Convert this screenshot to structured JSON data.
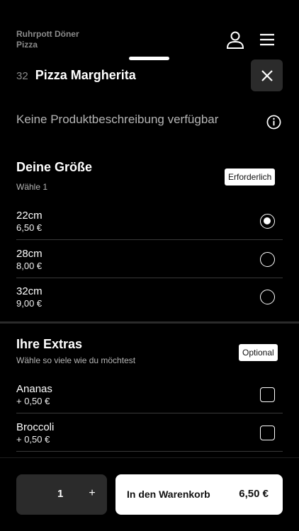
{
  "header": {
    "brand_line1": "Ruhrpott Döner",
    "brand_line2": "Pizza",
    "icons": [
      "user-icon",
      "menu-icon"
    ]
  },
  "product": {
    "number": "32",
    "name": "Pizza Margherita",
    "description": "Keine Produktbeschreibung verfügbar",
    "icons": [
      "close-icon",
      "info-icon"
    ]
  },
  "size_section": {
    "title": "Deine Größe",
    "subtitle": "Wähle 1",
    "badge": "Erforderlich",
    "options": [
      {
        "name": "22cm",
        "price": "6,50 €",
        "selected": true
      },
      {
        "name": "28cm",
        "price": "8,00 €",
        "selected": false
      },
      {
        "name": "32cm",
        "price": "9,00 €",
        "selected": false
      }
    ]
  },
  "extras_section": {
    "title": "Ihre Extras",
    "subtitle": "Wähle so viele wie du möchtest",
    "badge": "Optional",
    "options": [
      {
        "name": "Ananas",
        "price": "+ 0,50 €",
        "checked": false
      },
      {
        "name": "Broccoli",
        "price": "+ 0,50 €",
        "checked": false
      }
    ]
  },
  "footer": {
    "quantity": "1",
    "plus_label": "+",
    "cart_label": "In den Warenkorb",
    "cart_price": "6,50 €"
  },
  "colors": {
    "background": "#000000",
    "surface": "#2b2b2b",
    "text": "#ffffff",
    "muted": "#8a8a8a"
  }
}
